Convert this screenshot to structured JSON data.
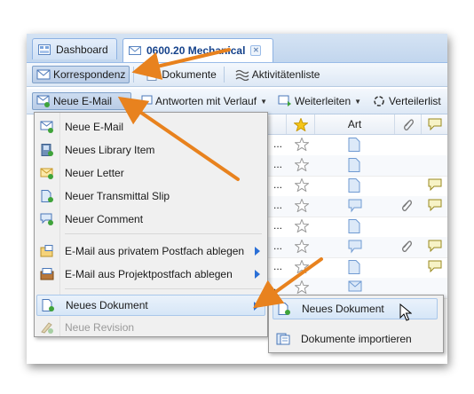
{
  "tabs": [
    {
      "label": "Dashboard",
      "active": false
    },
    {
      "label": "0600.20 Mechanical",
      "active": true,
      "close": "✕"
    }
  ],
  "toolbar1": {
    "items": [
      {
        "label": "Korrespondenz",
        "pressed": true
      },
      {
        "label": "Dokumente",
        "pressed": false
      },
      {
        "label": "Aktivitätenliste",
        "pressed": false
      }
    ]
  },
  "toolbar2": {
    "items": [
      {
        "label": "Neue E-Mail",
        "dropdown": true
      },
      {
        "label": "Antworten mit Verlauf",
        "dropdown": true
      },
      {
        "label": "Weiterleiten",
        "dropdown": true
      },
      {
        "label": "Verteilerlist"
      }
    ]
  },
  "grid": {
    "col_art": "Art",
    "rows": [
      "...",
      "...",
      "...",
      "...",
      "...",
      "...",
      "...",
      "..."
    ]
  },
  "menu": {
    "items": [
      {
        "label": "Neue E-Mail"
      },
      {
        "label": "Neues Library Item"
      },
      {
        "label": "Neuer Letter"
      },
      {
        "label": "Neuer Transmittal Slip"
      },
      {
        "label": "Neuer Comment"
      },
      {
        "label": "E-Mail aus privatem Postfach ablegen"
      },
      {
        "label": "E-Mail aus Projektpostfach ablegen"
      },
      {
        "label": "Neues Dokument"
      },
      {
        "label": "Neue Revision"
      }
    ]
  },
  "submenu": {
    "items": [
      {
        "label": "Neues Dokument"
      },
      {
        "label": "Dokumente importieren"
      }
    ]
  },
  "colors": {
    "accent_arrow": "#e8821e",
    "header_blue": "#15428b"
  }
}
